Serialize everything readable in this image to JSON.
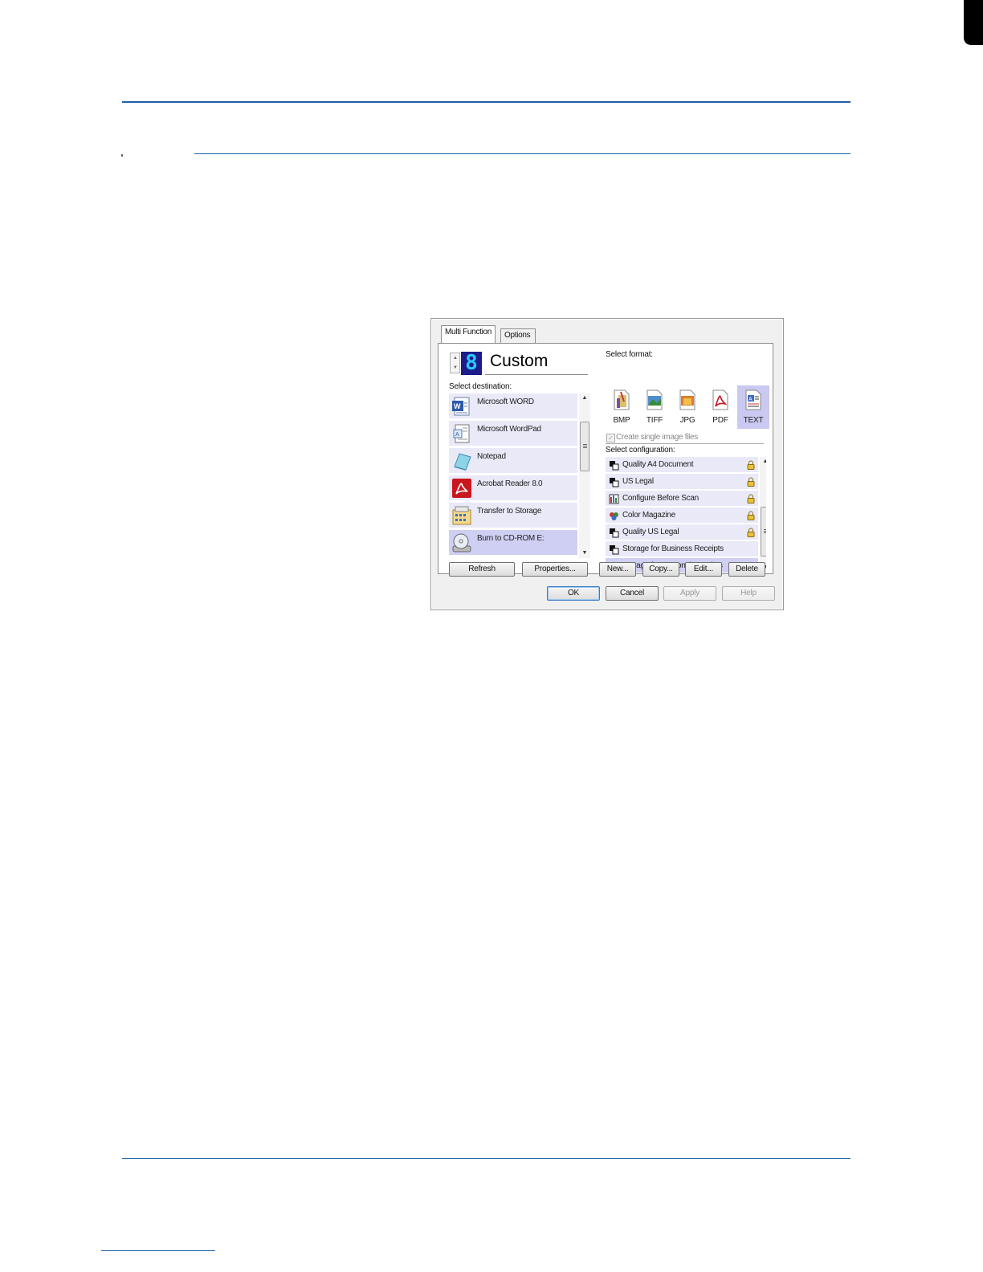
{
  "colors": {
    "rule": "#1f5fa8",
    "selection": "#cfcff3",
    "list_bg": "#e9e9f8",
    "digit_bg": "#1b1b8a",
    "digit_fg": "#28c8ff"
  },
  "dialog": {
    "tabs": [
      {
        "label": "Multi Function"
      },
      {
        "label": "Options"
      }
    ],
    "button_number": "8",
    "button_name": "Custom",
    "destination": {
      "label": "Select destination:",
      "items": [
        {
          "label": "Microsoft WORD",
          "icon": "word-icon"
        },
        {
          "label": "Microsoft WordPad",
          "icon": "wordpad-icon"
        },
        {
          "label": "Notepad",
          "icon": "notepad-icon"
        },
        {
          "label": "Acrobat Reader 8.0",
          "icon": "acrobat-icon"
        },
        {
          "label": "Transfer to Storage",
          "icon": "storage-icon"
        },
        {
          "label": "Burn to CD-ROM  E:",
          "icon": "cd-burn-icon",
          "selected": true
        }
      ],
      "refresh_label": "Refresh",
      "properties_label": "Properties..."
    },
    "format": {
      "label": "Select format:",
      "items": [
        {
          "label": "BMP",
          "icon": "bmp-icon"
        },
        {
          "label": "TIFF",
          "icon": "tiff-icon"
        },
        {
          "label": "JPG",
          "icon": "jpg-icon"
        },
        {
          "label": "PDF",
          "icon": "pdf-icon"
        },
        {
          "label": "TEXT",
          "icon": "text-icon",
          "selected": true
        }
      ],
      "single_image_label": "Create single image files",
      "single_image_checked": true,
      "single_image_disabled": true
    },
    "configuration": {
      "label": "Select configuration:",
      "items": [
        {
          "label": "Quality A4 Document",
          "icon": "bw-config-icon",
          "locked": true
        },
        {
          "label": "US Legal",
          "icon": "bw-config-icon",
          "locked": true
        },
        {
          "label": "Configure Before Scan",
          "icon": "configure-before-scan-icon",
          "locked": true
        },
        {
          "label": "Color Magazine",
          "icon": "color-config-icon",
          "locked": true
        },
        {
          "label": "Quality US Legal",
          "icon": "bw-config-icon",
          "locked": true
        },
        {
          "label": "Storage for Business Receipts",
          "icon": "bw-config-icon",
          "locked": false
        },
        {
          "label": "Storage for Personal Receipts",
          "icon": "bw-config-icon",
          "locked": false,
          "selected": true
        }
      ],
      "new_label": "New...",
      "copy_label": "Copy...",
      "edit_label": "Edit...",
      "delete_label": "Delete"
    },
    "ok_label": "OK",
    "cancel_label": "Cancel",
    "apply_label": "Apply",
    "help_label": "Help"
  }
}
